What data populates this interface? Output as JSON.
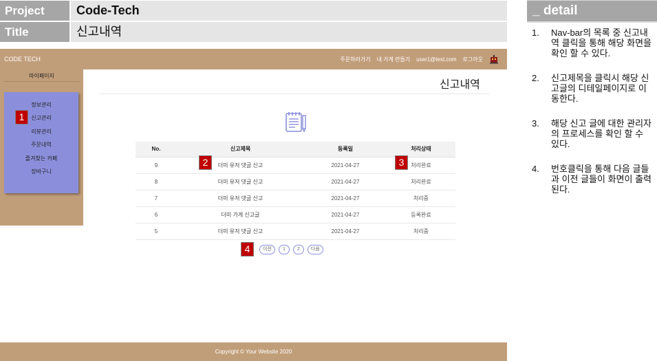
{
  "meta": {
    "project_label": "Project",
    "project_value": "Code-Tech",
    "title_label": "Title",
    "title_value": "신고내역"
  },
  "detail": {
    "heading": "_ detail",
    "items": [
      {
        "num": "1.",
        "text": "Nav-bar의 목록 중 신고내역 클릭을 통해 해당 화면을 확인 할 수 있다."
      },
      {
        "num": "2.",
        "text": "신고제목을 클릭시 해당 신고글의 디테일페이지로 이동한다."
      },
      {
        "num": "3.",
        "text": "해당 신고 글에 대한 관리자의 프로세스를 확인 할 수 있다."
      },
      {
        "num": "4.",
        "text": "번호클릭을 통해 다음 글들과 이전 글들이 화면이 출력된다."
      }
    ]
  },
  "app": {
    "brand": "CODE TECH",
    "nav": [
      "주문하러가기",
      "내 가게 만들기",
      "user1@test.com",
      "로그아웃"
    ],
    "sidebar": {
      "title": "마이페이지",
      "items": [
        "정보관리",
        "신고관리",
        "리뷰관리",
        "주문내역",
        "즐겨찾는 카페",
        "장바구니"
      ]
    },
    "page_title": "신고내역",
    "table": {
      "headers": [
        "No.",
        "신고제목",
        "등록일",
        "처리상태"
      ],
      "rows": [
        [
          "9",
          "더미 유저 댓글 신고",
          "2021-04-27",
          "처리완료"
        ],
        [
          "8",
          "더미 유저 댓글 신고",
          "2021-04-27",
          "처리완료"
        ],
        [
          "7",
          "더미 유저 댓글 신고",
          "2021-04-27",
          "처리중"
        ],
        [
          "6",
          "더미 가게 신고글",
          "2021-04-27",
          "등록완료"
        ],
        [
          "5",
          "더미 유저 댓글 신고",
          "2021-04-27",
          "처리중"
        ]
      ]
    },
    "pager": {
      "prev": "이전",
      "pages": [
        "1",
        "2"
      ],
      "next": "다음"
    },
    "footer": "Copyright © Your Website 2020"
  },
  "badges": [
    "1",
    "2",
    "3",
    "4"
  ],
  "colors": {
    "accent_brown": "#c19e7a",
    "menu_purple": "#8b8fdb",
    "badge_red": "#c00000"
  },
  "icons": {
    "robot": "robot-icon",
    "notepad": "notepad-icon"
  }
}
